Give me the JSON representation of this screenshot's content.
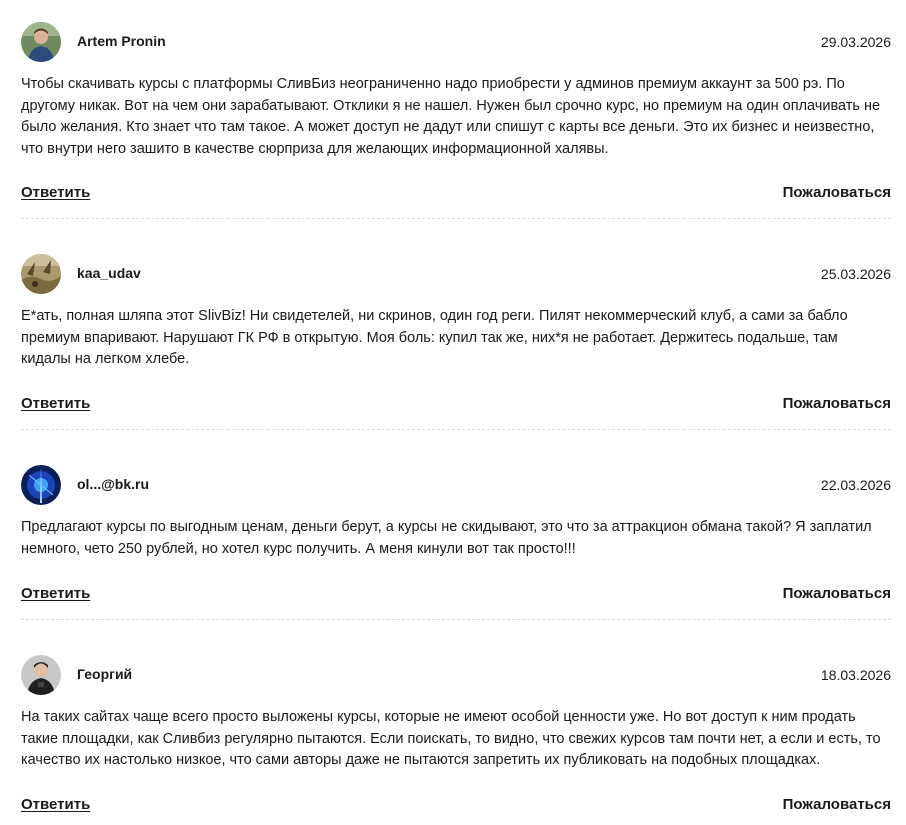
{
  "reviews": [
    {
      "author": "Artem Pronin",
      "date": "29.03.2026",
      "avatar_icon": "user-photo-avatar",
      "text": "Чтобы скачивать курсы с платформы СливБиз неограниченно надо приобрести у админов премиум аккаунт за 500 рэ. По другому никак. Вот на чем они зарабатывают. Отклики я не нашел. Нужен был срочно курс, но премиум на один оплачивать не было желания. Кто знает что там такое. А может доступ не дадут или спишут с карты все деньги. Это их бизнес и неизвестно, что внутри него зашито в качестве сюрприза для желающих информационной халявы.",
      "reply_label": "Ответить",
      "report_label": "Пожаловаться"
    },
    {
      "author": "kaa_udav",
      "date": "25.03.2026",
      "avatar_icon": "landscape-photo-avatar",
      "text": "Е*ать, полная шляпа этот SlivBiz! Ни свидетелей, ни скринов, один год реги. Пилят некоммерческий клуб, а сами за бабло премиум впаривают. Нарушают ГК РФ в открытую. Моя боль: купил так же, них*я не работает. Держитесь подальше, там кидалы на легком хлебе.",
      "reply_label": "Ответить",
      "report_label": "Пожаловаться"
    },
    {
      "author": "ol...@bk.ru",
      "date": "22.03.2026",
      "avatar_icon": "blue-light-avatar",
      "text": "Предлагают курсы по выгодным ценам, деньги берут, а курсы не скидывают, это что за аттракцион обмана такой? Я заплатил немного, чето 250 рублей, но хотел курс получить. А меня кинули вот так просто!!!",
      "reply_label": "Ответить",
      "report_label": "Пожаловаться"
    },
    {
      "author": "Георгий",
      "date": "18.03.2026",
      "avatar_icon": "user-photo-avatar",
      "text": "На таких сайтах чаще всего просто выложены курсы, которые не имеют особой ценности уже. Но вот доступ к ним продать такие площадки, как Сливбиз регулярно пытаются. Если поискать, то видно, что свежих курсов там почти нет, а если и есть, то качество их настолько низкое, что сами авторы даже не пытаются запретить их публиковать на подобных площадках.",
      "reply_label": "Ответить",
      "report_label": "Пожаловаться"
    }
  ],
  "colors": {
    "text": "#1a1a1a",
    "divider": "#dcdcdc",
    "background": "#ffffff"
  }
}
